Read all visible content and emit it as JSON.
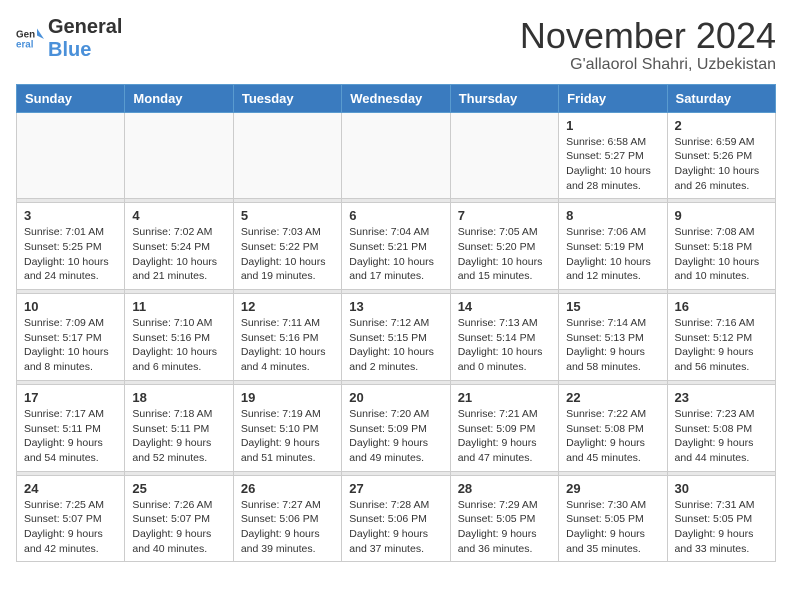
{
  "header": {
    "logo_general": "General",
    "logo_blue": "Blue",
    "month": "November 2024",
    "location": "G'allaorol Shahri, Uzbekistan"
  },
  "weekdays": [
    "Sunday",
    "Monday",
    "Tuesday",
    "Wednesday",
    "Thursday",
    "Friday",
    "Saturday"
  ],
  "weeks": [
    [
      {
        "day": "",
        "info": ""
      },
      {
        "day": "",
        "info": ""
      },
      {
        "day": "",
        "info": ""
      },
      {
        "day": "",
        "info": ""
      },
      {
        "day": "",
        "info": ""
      },
      {
        "day": "1",
        "info": "Sunrise: 6:58 AM\nSunset: 5:27 PM\nDaylight: 10 hours and 28 minutes."
      },
      {
        "day": "2",
        "info": "Sunrise: 6:59 AM\nSunset: 5:26 PM\nDaylight: 10 hours and 26 minutes."
      }
    ],
    [
      {
        "day": "3",
        "info": "Sunrise: 7:01 AM\nSunset: 5:25 PM\nDaylight: 10 hours and 24 minutes."
      },
      {
        "day": "4",
        "info": "Sunrise: 7:02 AM\nSunset: 5:24 PM\nDaylight: 10 hours and 21 minutes."
      },
      {
        "day": "5",
        "info": "Sunrise: 7:03 AM\nSunset: 5:22 PM\nDaylight: 10 hours and 19 minutes."
      },
      {
        "day": "6",
        "info": "Sunrise: 7:04 AM\nSunset: 5:21 PM\nDaylight: 10 hours and 17 minutes."
      },
      {
        "day": "7",
        "info": "Sunrise: 7:05 AM\nSunset: 5:20 PM\nDaylight: 10 hours and 15 minutes."
      },
      {
        "day": "8",
        "info": "Sunrise: 7:06 AM\nSunset: 5:19 PM\nDaylight: 10 hours and 12 minutes."
      },
      {
        "day": "9",
        "info": "Sunrise: 7:08 AM\nSunset: 5:18 PM\nDaylight: 10 hours and 10 minutes."
      }
    ],
    [
      {
        "day": "10",
        "info": "Sunrise: 7:09 AM\nSunset: 5:17 PM\nDaylight: 10 hours and 8 minutes."
      },
      {
        "day": "11",
        "info": "Sunrise: 7:10 AM\nSunset: 5:16 PM\nDaylight: 10 hours and 6 minutes."
      },
      {
        "day": "12",
        "info": "Sunrise: 7:11 AM\nSunset: 5:16 PM\nDaylight: 10 hours and 4 minutes."
      },
      {
        "day": "13",
        "info": "Sunrise: 7:12 AM\nSunset: 5:15 PM\nDaylight: 10 hours and 2 minutes."
      },
      {
        "day": "14",
        "info": "Sunrise: 7:13 AM\nSunset: 5:14 PM\nDaylight: 10 hours and 0 minutes."
      },
      {
        "day": "15",
        "info": "Sunrise: 7:14 AM\nSunset: 5:13 PM\nDaylight: 9 hours and 58 minutes."
      },
      {
        "day": "16",
        "info": "Sunrise: 7:16 AM\nSunset: 5:12 PM\nDaylight: 9 hours and 56 minutes."
      }
    ],
    [
      {
        "day": "17",
        "info": "Sunrise: 7:17 AM\nSunset: 5:11 PM\nDaylight: 9 hours and 54 minutes."
      },
      {
        "day": "18",
        "info": "Sunrise: 7:18 AM\nSunset: 5:11 PM\nDaylight: 9 hours and 52 minutes."
      },
      {
        "day": "19",
        "info": "Sunrise: 7:19 AM\nSunset: 5:10 PM\nDaylight: 9 hours and 51 minutes."
      },
      {
        "day": "20",
        "info": "Sunrise: 7:20 AM\nSunset: 5:09 PM\nDaylight: 9 hours and 49 minutes."
      },
      {
        "day": "21",
        "info": "Sunrise: 7:21 AM\nSunset: 5:09 PM\nDaylight: 9 hours and 47 minutes."
      },
      {
        "day": "22",
        "info": "Sunrise: 7:22 AM\nSunset: 5:08 PM\nDaylight: 9 hours and 45 minutes."
      },
      {
        "day": "23",
        "info": "Sunrise: 7:23 AM\nSunset: 5:08 PM\nDaylight: 9 hours and 44 minutes."
      }
    ],
    [
      {
        "day": "24",
        "info": "Sunrise: 7:25 AM\nSunset: 5:07 PM\nDaylight: 9 hours and 42 minutes."
      },
      {
        "day": "25",
        "info": "Sunrise: 7:26 AM\nSunset: 5:07 PM\nDaylight: 9 hours and 40 minutes."
      },
      {
        "day": "26",
        "info": "Sunrise: 7:27 AM\nSunset: 5:06 PM\nDaylight: 9 hours and 39 minutes."
      },
      {
        "day": "27",
        "info": "Sunrise: 7:28 AM\nSunset: 5:06 PM\nDaylight: 9 hours and 37 minutes."
      },
      {
        "day": "28",
        "info": "Sunrise: 7:29 AM\nSunset: 5:05 PM\nDaylight: 9 hours and 36 minutes."
      },
      {
        "day": "29",
        "info": "Sunrise: 7:30 AM\nSunset: 5:05 PM\nDaylight: 9 hours and 35 minutes."
      },
      {
        "day": "30",
        "info": "Sunrise: 7:31 AM\nSunset: 5:05 PM\nDaylight: 9 hours and 33 minutes."
      }
    ]
  ]
}
